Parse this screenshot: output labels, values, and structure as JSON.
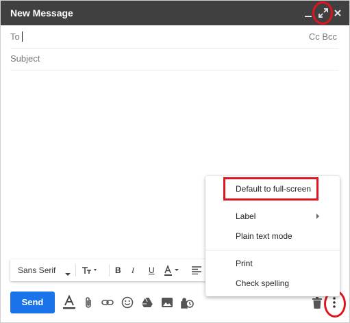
{
  "window": {
    "title": "New Message"
  },
  "fields": {
    "to_label": "To",
    "cc_label": "Cc",
    "bcc_label": "Bcc",
    "subject_placeholder": "Subject"
  },
  "format_bar": {
    "font": "Sans Serif"
  },
  "menu": {
    "default_full_screen": "Default to full-screen",
    "label": "Label",
    "plain_text_mode": "Plain text mode",
    "print": "Print",
    "check_spelling": "Check spelling"
  },
  "toolbar": {
    "send_label": "Send"
  },
  "colors": {
    "titlebar": "#404040",
    "send_button": "#1a73e8",
    "annotation_red": "#e0141e"
  },
  "icons": [
    "minimize-icon",
    "full-screen-icon",
    "close-icon",
    "text-size-icon",
    "bold-icon",
    "italic-icon",
    "underline-icon",
    "text-color-icon",
    "align-icon",
    "formatting-icon",
    "attach-icon",
    "link-icon",
    "emoji-icon",
    "drive-icon",
    "photo-icon",
    "confidential-icon",
    "trash-icon",
    "more-options-icon",
    "submenu-arrow-icon"
  ]
}
